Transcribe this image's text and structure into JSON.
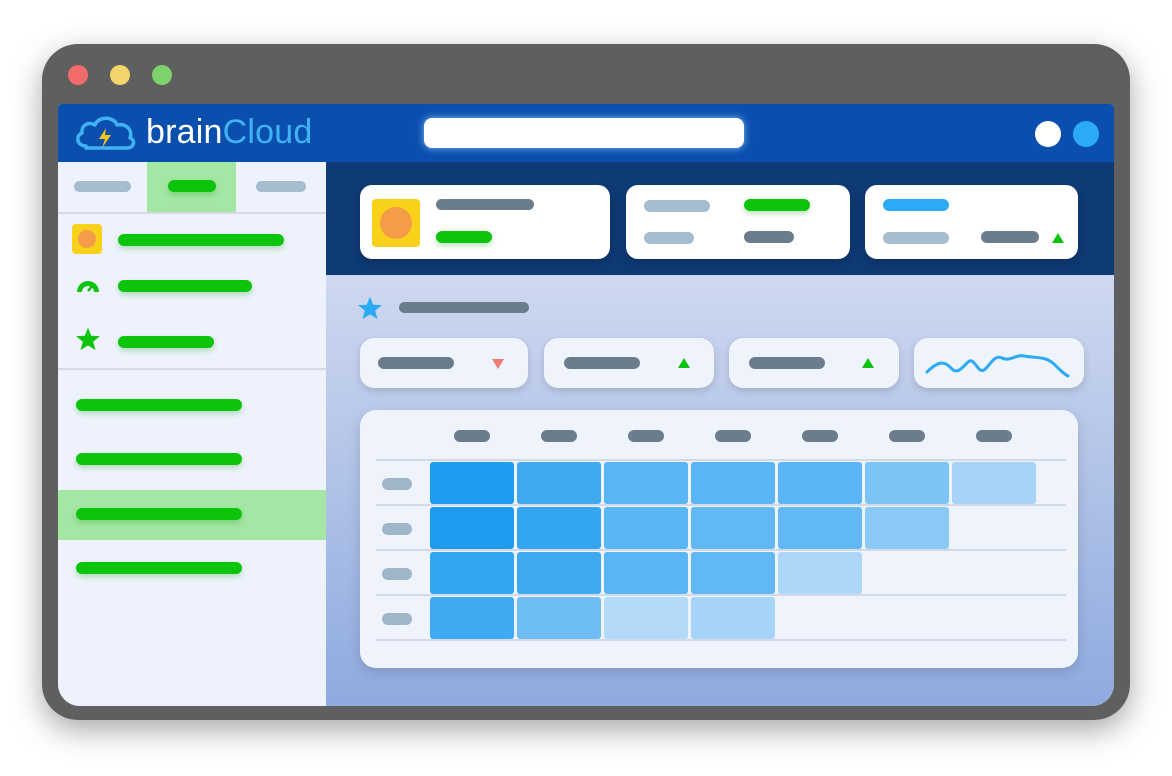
{
  "window": {
    "controls": [
      {
        "name": "close",
        "color": "#f26b6b"
      },
      {
        "name": "minimize",
        "color": "#f2d46b"
      },
      {
        "name": "maximize",
        "color": "#7fd36b"
      }
    ]
  },
  "header": {
    "logo": {
      "part1": "brain",
      "part2": "Cloud",
      "icon": "cloud-lightning-icon"
    },
    "buttons": [
      {
        "name": "profile",
        "color": "#ffffff"
      },
      {
        "name": "status",
        "color": "#2baaf5"
      }
    ]
  },
  "sidebar": {
    "tabs": [
      {
        "id": "tab-1",
        "active": false
      },
      {
        "id": "tab-2",
        "active": true
      },
      {
        "id": "tab-3",
        "active": false
      }
    ],
    "top_items": [
      {
        "icon": "app-avatar-icon"
      },
      {
        "icon": "gauge-icon"
      },
      {
        "icon": "star-icon"
      }
    ],
    "nav_items": [
      {
        "active": false
      },
      {
        "active": false
      },
      {
        "active": true
      },
      {
        "active": false
      }
    ]
  },
  "main": {
    "section_icon": "star-icon",
    "filters": [
      {
        "trend": "down"
      },
      {
        "trend": "up"
      },
      {
        "trend": "up"
      },
      {
        "type": "sparkline-icon"
      }
    ],
    "table": {
      "columns": 7,
      "rows": [
        {
          "shades": [
            1.0,
            0.85,
            0.72,
            0.72,
            0.72,
            0.55,
            0.35
          ]
        },
        {
          "shades": [
            1.0,
            0.9,
            0.72,
            0.68,
            0.68,
            0.48
          ]
        },
        {
          "shades": [
            0.9,
            0.85,
            0.72,
            0.68,
            0.32
          ]
        },
        {
          "shades": [
            0.85,
            0.62,
            0.28,
            0.35
          ]
        }
      ]
    }
  },
  "colors": {
    "accent_green": "#0bc40b",
    "header_blue": "#0b4fae",
    "band_navy": "#0e3a75",
    "cell_blue": "#1e9cf0"
  }
}
